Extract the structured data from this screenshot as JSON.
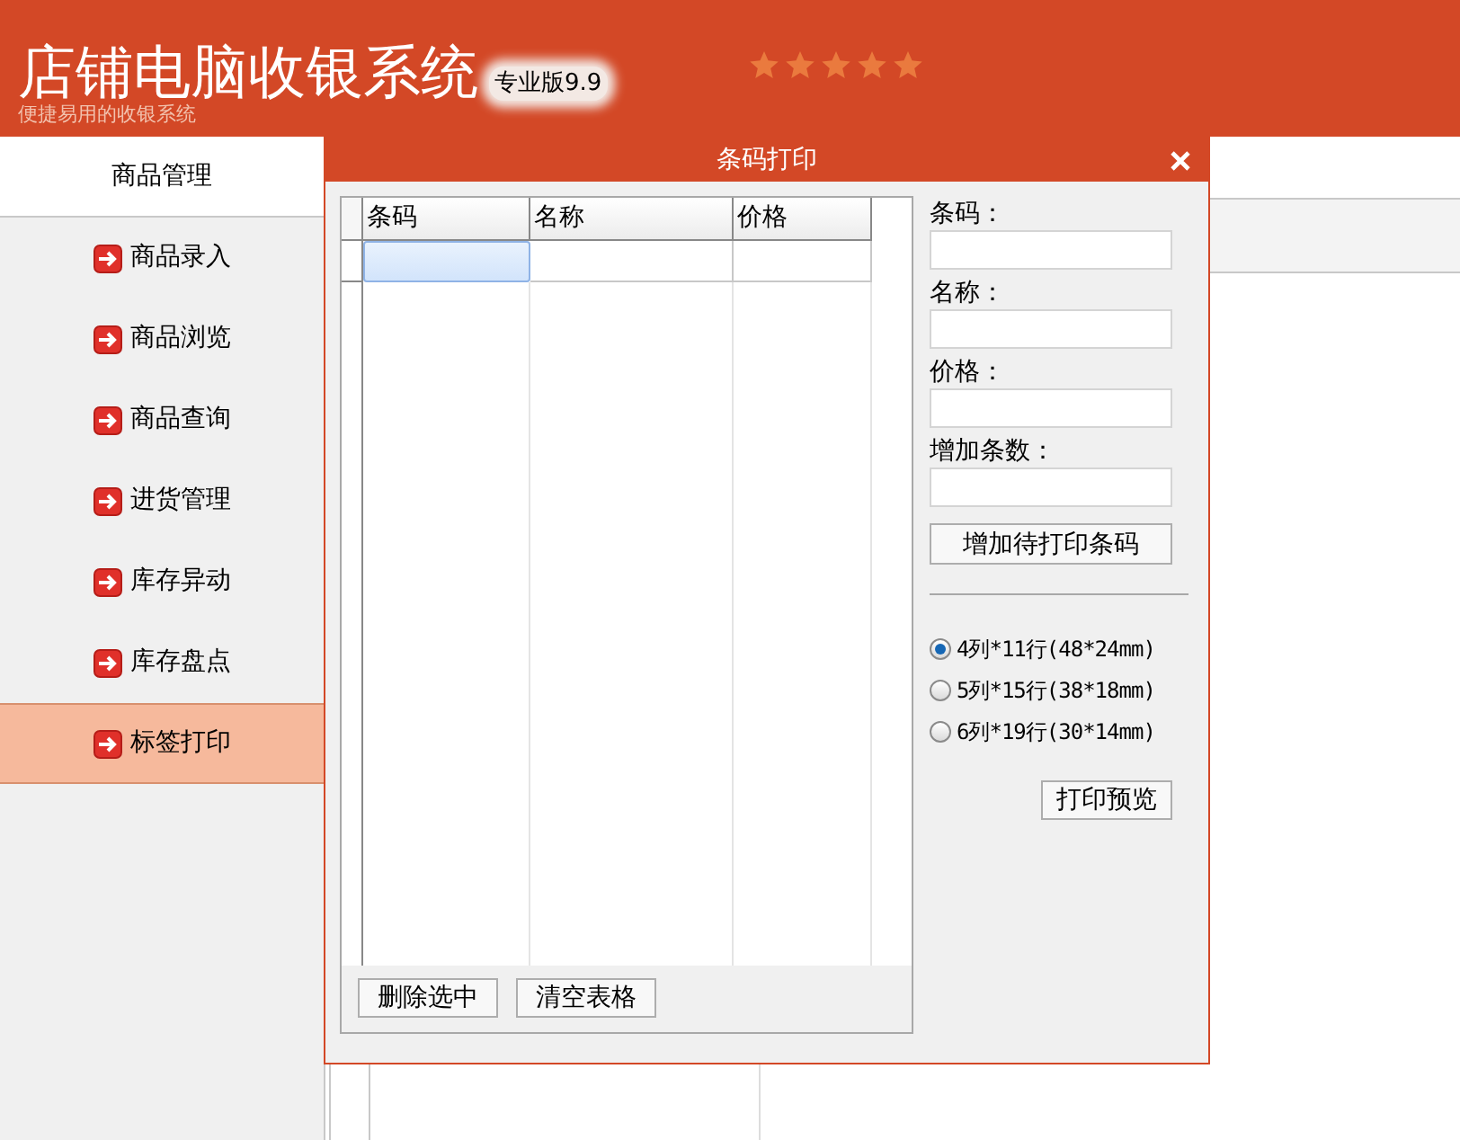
{
  "app": {
    "title": "店铺电脑收银系统",
    "edition": "专业版9.9",
    "subtitle": "便捷易用的收银系统",
    "rating": {
      "stars": 5
    }
  },
  "sidebar": {
    "header": "商品管理",
    "items": [
      {
        "label": "商品录入",
        "selected": false
      },
      {
        "label": "商品浏览",
        "selected": false
      },
      {
        "label": "商品查询",
        "selected": false
      },
      {
        "label": "进货管理",
        "selected": false
      },
      {
        "label": "库存异动",
        "selected": false
      },
      {
        "label": "库存盘点",
        "selected": false
      },
      {
        "label": "标签打印",
        "selected": true
      }
    ]
  },
  "dialog": {
    "title": "条码打印",
    "table": {
      "columns": [
        "条码",
        "名称",
        "价格"
      ]
    },
    "table_buttons": [
      "删除选中",
      "清空表格"
    ],
    "fields": [
      {
        "label": "条码："
      },
      {
        "label": "名称："
      },
      {
        "label": "价格："
      },
      {
        "label": "增加条数："
      }
    ],
    "add_button": "增加待打印条码",
    "layouts": [
      {
        "label": "4列*11行(48*24mm)",
        "selected": true
      },
      {
        "label": "5列*15行(38*18mm)",
        "selected": false
      },
      {
        "label": "6列*19行(30*14mm)",
        "selected": false
      }
    ],
    "preview_button": "打印预览"
  }
}
